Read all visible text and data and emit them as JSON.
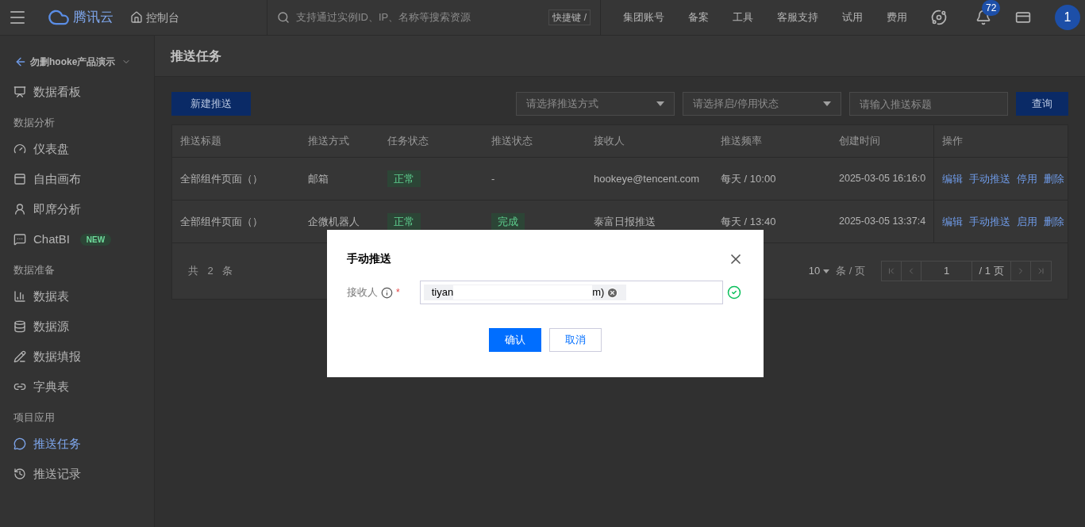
{
  "header": {
    "brand": "腾讯云",
    "console": "控制台",
    "search_placeholder": "支持通过实例ID、IP、名称等搜索资源",
    "shortcut": "快捷键 /",
    "nav": [
      "集团账号",
      "备案",
      "工具",
      "客服支持",
      "试用",
      "费用"
    ],
    "badge": "72",
    "avatar": "1"
  },
  "sidebar": {
    "project": "勿删hooke产品演示",
    "groups": [
      {
        "items": [
          {
            "label": "数据看板",
            "selected": false
          }
        ]
      },
      {
        "title": "数据分析",
        "items": [
          {
            "label": "仪表盘",
            "selected": false
          },
          {
            "label": "自由画布",
            "selected": false
          },
          {
            "label": "即席分析",
            "selected": false
          },
          {
            "label": "ChatBI",
            "selected": false,
            "badge": "NEW"
          }
        ]
      },
      {
        "title": "数据准备",
        "items": [
          {
            "label": "数据表",
            "selected": false
          },
          {
            "label": "数据源",
            "selected": false
          },
          {
            "label": "数据填报",
            "selected": false
          },
          {
            "label": "字典表",
            "selected": false
          }
        ]
      },
      {
        "title": "项目应用",
        "items": [
          {
            "label": "推送任务",
            "selected": true
          },
          {
            "label": "推送记录",
            "selected": false
          }
        ]
      }
    ]
  },
  "page_title": "推送任务",
  "toolbar": {
    "new_button": "新建推送",
    "method_placeholder": "请选择推送方式",
    "status_placeholder": "请选择启/停用状态",
    "title_placeholder": "请输入推送标题",
    "query_button": "查询"
  },
  "table": {
    "columns": [
      "推送标题",
      "推送方式",
      "任务状态",
      "推送状态",
      "接收人",
      "推送频率",
      "创建时间",
      "操作"
    ],
    "rows": [
      {
        "title": "全部组件页面（）",
        "method": "邮箱",
        "task_status": {
          "kind": "tag",
          "text": "正常"
        },
        "push_status": {
          "kind": "text",
          "text": "-"
        },
        "receiver": "hookeye@tencent.com",
        "frequency": "每天 / 10:00",
        "created": "2025-03-05 16:16:0",
        "actions": [
          "编辑",
          "手动推送",
          "停用",
          "删除"
        ]
      },
      {
        "title": "全部组件页面（）",
        "method": "企微机器人",
        "task_status": {
          "kind": "tag",
          "text": "正常"
        },
        "push_status": {
          "kind": "tag",
          "text": "完成"
        },
        "receiver": "泰富日报推送",
        "frequency": "每天 / 13:40",
        "created": "2025-03-05 13:37:4",
        "actions": [
          "编辑",
          "手动推送",
          "启用",
          "删除"
        ]
      }
    ]
  },
  "pagination": {
    "total": "共 2 条",
    "page_size": "10",
    "page_size_unit": "条 / 页",
    "page": "1",
    "page_count": "/ 1 页"
  },
  "dialog": {
    "title": "手动推送",
    "field_label": "接收人",
    "required_mark": "*",
    "tag_start": "tiyan",
    "tag_end": "m)",
    "valid": true,
    "confirm": "确认",
    "cancel": "取消"
  }
}
